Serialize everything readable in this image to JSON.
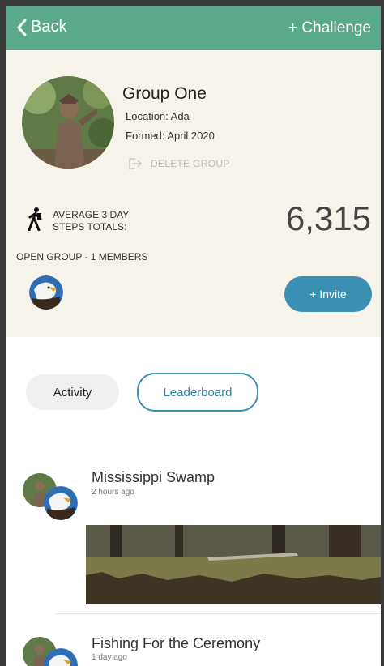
{
  "nav": {
    "back_label": "Back",
    "challenge_label": "+ Challenge",
    "bar_color": "#5aa98a"
  },
  "group": {
    "name": "Group One",
    "location": "Location: Ada",
    "formed": "Formed: April 2020",
    "delete_label": "DELETE GROUP"
  },
  "stats": {
    "steps_label_line1": "AVERAGE 3 DAY",
    "steps_label_line2": "STEPS TOTALS:",
    "steps_value": "6,315",
    "members_label": "OPEN GROUP - 1 MEMBERS",
    "invite_label": "+ Invite"
  },
  "tabs": [
    {
      "label": "Activity",
      "selected": true
    },
    {
      "label": "Leaderboard",
      "selected": false
    }
  ],
  "feed": [
    {
      "title": "Mississippi Swamp",
      "time": "2 hours ago",
      "has_image": true
    },
    {
      "title": "Fishing For the Ceremony",
      "time": "1 day ago",
      "has_image": false
    }
  ],
  "colors": {
    "accent": "#3a8fb3",
    "card_bg": "#f5f3ea",
    "muted": "#b9b9b9"
  },
  "icons": [
    "chevron-left-icon",
    "exit-icon",
    "hiker-icon",
    "eagle-avatar-icon",
    "statue-avatar-icon"
  ]
}
